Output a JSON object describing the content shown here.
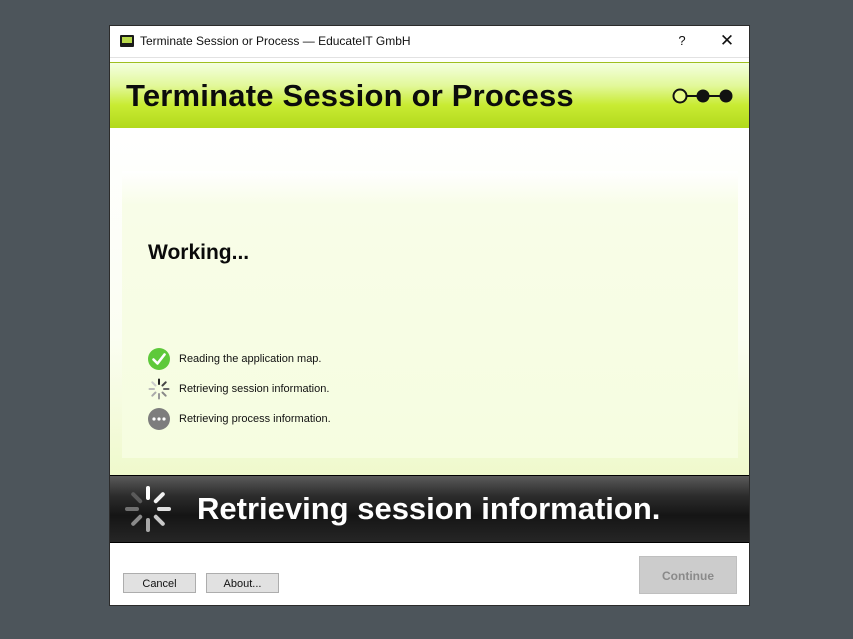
{
  "window": {
    "title": "Terminate Session or Process — EducateIT GmbH",
    "help_label": "?",
    "close_label": "✕"
  },
  "banner": {
    "title": "Terminate Session or Process",
    "steps": {
      "total": 3,
      "current": 1
    },
    "accent_color": "#c8eb32"
  },
  "main": {
    "heading": "Working...",
    "tasks": [
      {
        "label": "Reading the application map.",
        "state": "done",
        "icon": "check-circle-icon"
      },
      {
        "label": "Retrieving session information.",
        "state": "in-progress",
        "icon": "spinner-icon"
      },
      {
        "label": "Retrieving process information.",
        "state": "pending",
        "icon": "ellipsis-circle-icon"
      }
    ]
  },
  "status": {
    "text": "Retrieving session information.",
    "icon": "spinner-icon"
  },
  "footer": {
    "cancel_label": "Cancel",
    "about_label": "About...",
    "continue_label": "Continue",
    "continue_enabled": false
  }
}
